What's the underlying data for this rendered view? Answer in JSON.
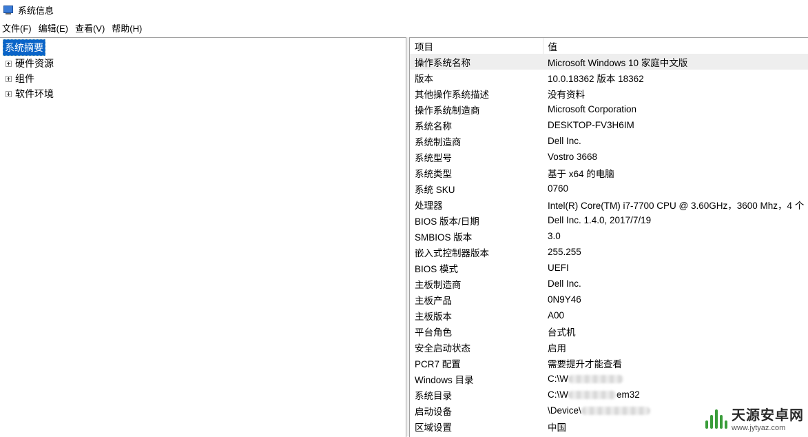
{
  "window": {
    "title": "系统信息"
  },
  "menu": [
    "文件(F)",
    "编辑(E)",
    "查看(V)",
    "帮助(H)"
  ],
  "tree": {
    "root": "系统摘要",
    "children": [
      "硬件资源",
      "组件",
      "软件环境"
    ]
  },
  "table": {
    "headers": [
      "项目",
      "值"
    ],
    "rows": [
      [
        "操作系统名称",
        "Microsoft Windows 10 家庭中文版"
      ],
      [
        "版本",
        "10.0.18362 版本 18362"
      ],
      [
        "其他操作系统描述",
        "没有资料"
      ],
      [
        "操作系统制造商",
        "Microsoft Corporation"
      ],
      [
        "系统名称",
        "DESKTOP-FV3H6IM"
      ],
      [
        "系统制造商",
        "Dell Inc."
      ],
      [
        "系统型号",
        "Vostro 3668"
      ],
      [
        "系统类型",
        "基于 x64 的电脑"
      ],
      [
        "系统 SKU",
        "0760"
      ],
      [
        "处理器",
        "Intel(R) Core(TM) i7-7700 CPU @ 3.60GHz，3600 Mhz，4 个"
      ],
      [
        "BIOS 版本/日期",
        "Dell Inc. 1.4.0, 2017/7/19"
      ],
      [
        "SMBIOS 版本",
        "3.0"
      ],
      [
        "嵌入式控制器版本",
        "255.255"
      ],
      [
        "BIOS 模式",
        "UEFI"
      ],
      [
        "主板制造商",
        "Dell Inc."
      ],
      [
        "主板产品",
        "0N9Y46"
      ],
      [
        "主板版本",
        "A00"
      ],
      [
        "平台角色",
        "台式机"
      ],
      [
        "安全启动状态",
        "启用"
      ],
      [
        "PCR7 配置",
        "需要提升才能查看"
      ],
      [
        "Windows 目录",
        "C:\\W"
      ],
      [
        "系统目录",
        "C:\\W"
      ],
      [
        "启动设备",
        "\\Device\\"
      ],
      [
        "区域设置",
        "中国"
      ]
    ],
    "blurred_suffix": {
      "21": "em32"
    }
  },
  "watermark": {
    "title": "天源安卓网",
    "url": "www.jytyaz.com"
  },
  "colors": {
    "selection": "#0a64c8",
    "watermark_green": "#3a9d3a"
  }
}
